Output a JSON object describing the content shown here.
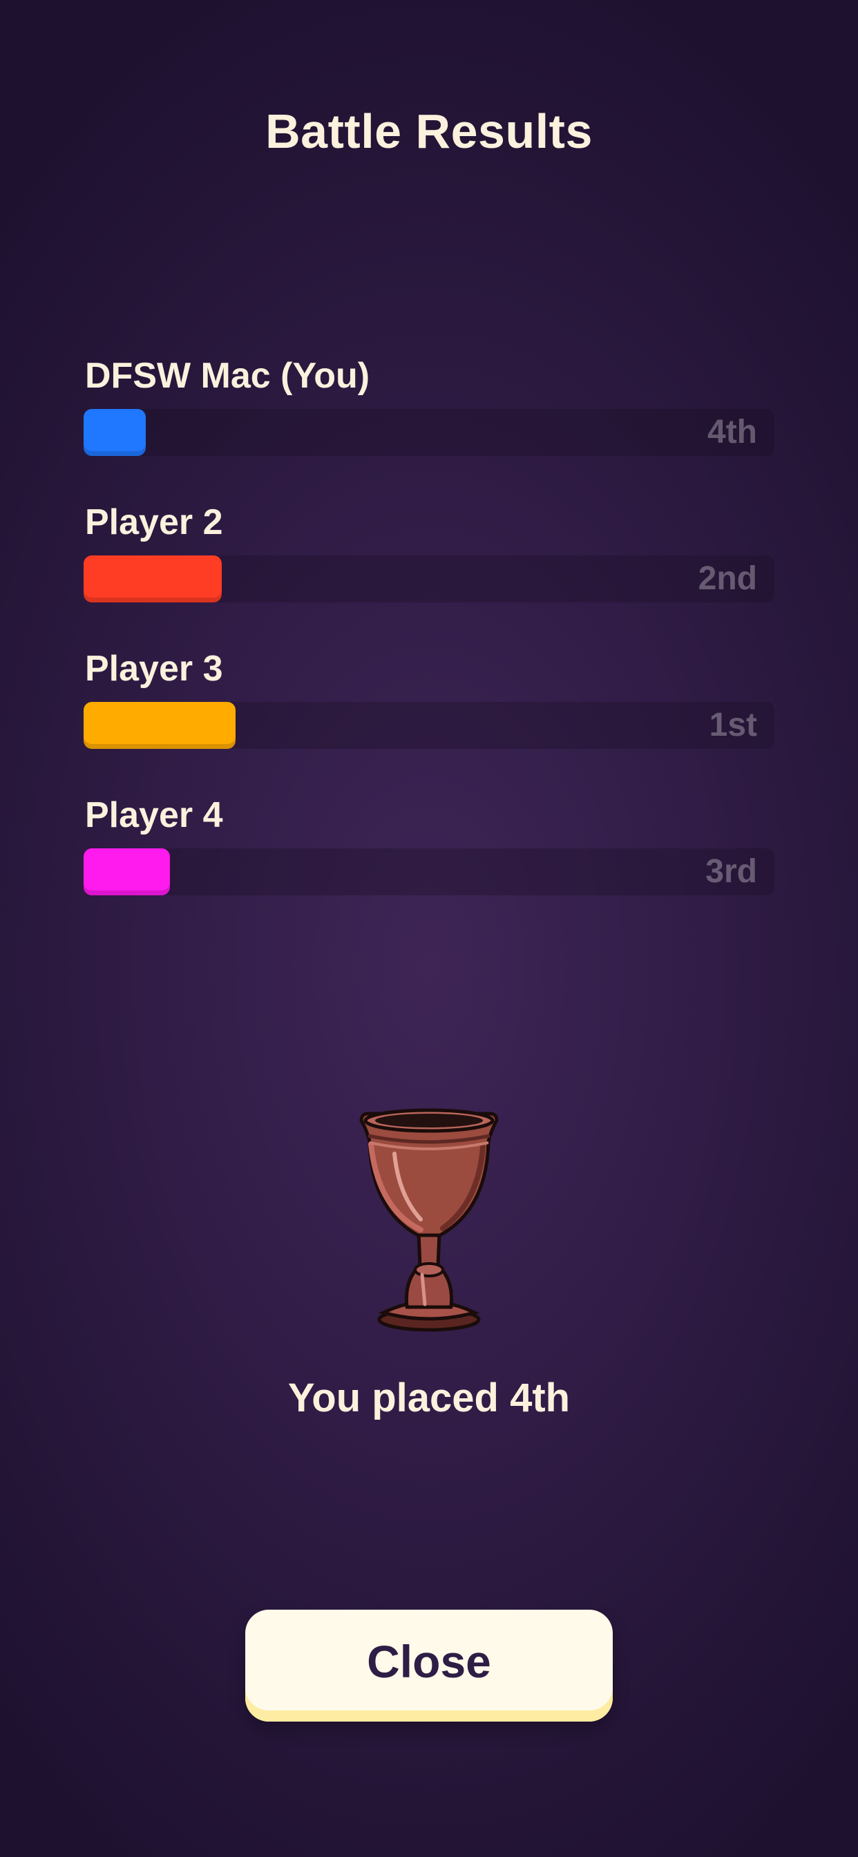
{
  "header": {
    "title": "Battle Results"
  },
  "players": [
    {
      "name": "DFSW Mac (You)",
      "place": "4th",
      "color": "#1f78ff",
      "progress": 0.09
    },
    {
      "name": "Player 2",
      "place": "2nd",
      "color": "#ff3d24",
      "progress": 0.2
    },
    {
      "name": "Player 3",
      "place": "1st",
      "color": "#ffab00",
      "progress": 0.22
    },
    {
      "name": "Player 4",
      "place": "3rd",
      "color": "#ff1aee",
      "progress": 0.125
    }
  ],
  "result": {
    "icon": "goblet-trophy-icon",
    "text": "You placed 4th"
  },
  "actions": {
    "close_label": "Close"
  }
}
